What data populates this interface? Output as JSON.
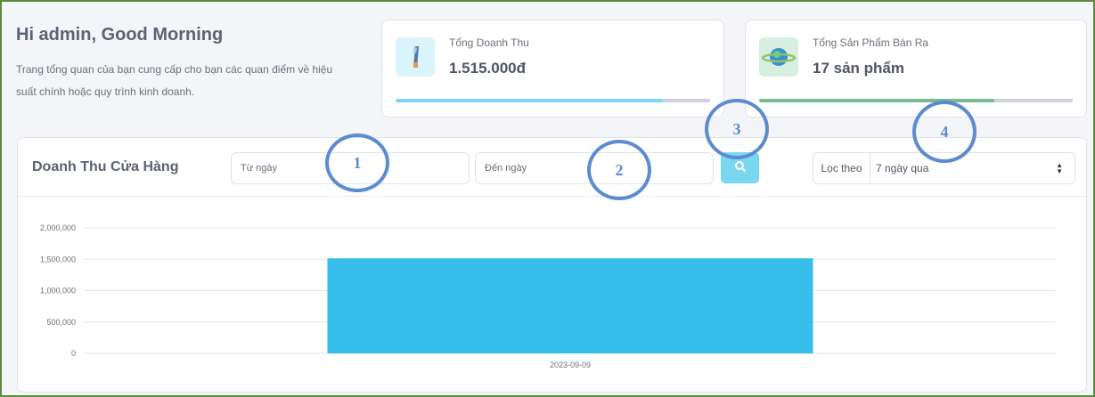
{
  "greeting": {
    "title": "Hi admin, Good Morning",
    "description": "Trang tổng quan của bạn cung cấp cho bạn các quan điểm về hiệu suất chính hoặc quy trình kinh doanh."
  },
  "stats": {
    "revenue": {
      "label": "Tổng Doanh Thu",
      "value": "1.515.000đ",
      "progress": 0.85,
      "icon": "revenue-icon"
    },
    "products": {
      "label": "Tổng Sản Phẩm Bán Ra",
      "value": "17 sản phẩm",
      "progress": 0.75,
      "icon": "planet-icon"
    }
  },
  "panel": {
    "title": "Doanh Thu Cửa Hàng",
    "from_placeholder": "Từ ngày",
    "to_placeholder": "Đến ngày",
    "search_icon": "search-icon",
    "filter_label": "Lọc theo",
    "filter_value": "7 ngày qua"
  },
  "markers": [
    "1",
    "2",
    "3",
    "4"
  ],
  "colors": {
    "accent": "#79d8f0",
    "bar": "#36bde9",
    "marker": "#5b8bd0",
    "frame": "#5b8a3a"
  },
  "chart_data": {
    "type": "bar",
    "categories": [
      "2023-09-09"
    ],
    "values": [
      1515000
    ],
    "yticks": [
      "0",
      "500,000",
      "1,000,000",
      "1,500,000",
      "2,000,000"
    ],
    "ylim": [
      0,
      2000000
    ],
    "grid": true,
    "title": "",
    "xlabel": "",
    "ylabel": ""
  }
}
